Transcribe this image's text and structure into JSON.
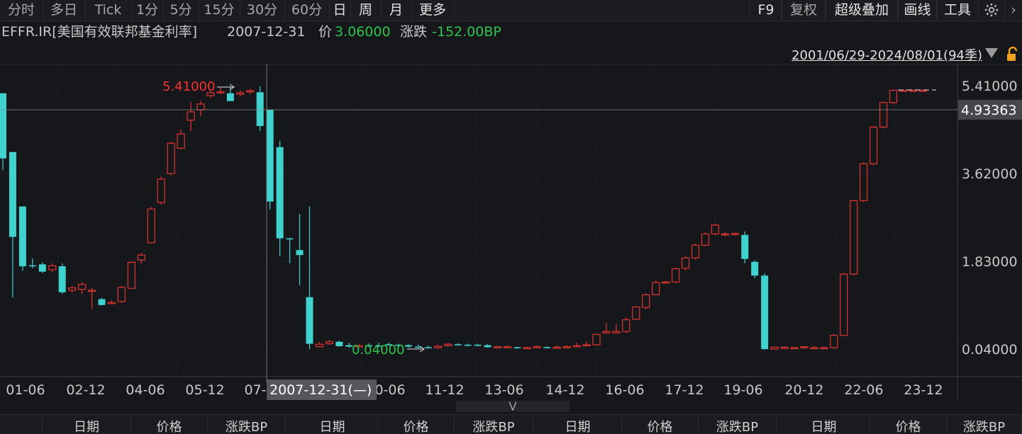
{
  "toolbar": {
    "left": [
      "分时",
      "多日",
      "Tick",
      "1分",
      "5分",
      "15分",
      "30分",
      "60分",
      "日",
      "周",
      "月",
      "更多"
    ],
    "right": [
      "F9",
      "复权",
      "超级叠加",
      "画线",
      "工具"
    ],
    "icons": [
      "gear-icon",
      "chevron-right-icon"
    ]
  },
  "info": {
    "symbol": "EFFR.IR[美国有效联邦基金利率]",
    "date": "2007-12-31",
    "price_label": "价",
    "price": "3.06000",
    "change_label": "涨跌",
    "change": "-152.00BP"
  },
  "range": {
    "label": "2001/06/29-2024/08/01(94季)"
  },
  "colors": {
    "up": "#e0342f",
    "down": "#3fd2cf",
    "up_text": "#ff3030",
    "down_text": "#2ec34a"
  },
  "chart_data": {
    "type": "candlestick",
    "ylim": [
      0,
      5.6
    ],
    "yticks": [
      "5.41000",
      "3.62000",
      "1.83000",
      "0.04000"
    ],
    "xticks": [
      "01-06",
      "02-12",
      "04-06",
      "05-12",
      "07-",
      "0-06",
      "11-12",
      "13-06",
      "14-12",
      "16-06",
      "17-12",
      "19-06",
      "20-12",
      "22-06",
      "23-12"
    ],
    "annotations": {
      "high": "5.41000",
      "low": "0.04000"
    },
    "crosshair": {
      "price": "4.93363",
      "date": "2007-12-31(—)"
    },
    "candles": [
      [
        5.27,
        3.94,
        5.27,
        3.7
      ],
      [
        4.07,
        2.34,
        4.07,
        1.1
      ],
      [
        2.96,
        1.74,
        2.96,
        1.65
      ],
      [
        1.76,
        1.75,
        1.9,
        1.7
      ],
      [
        1.78,
        1.63,
        1.82,
        1.6
      ],
      [
        1.67,
        1.75,
        1.8,
        1.62
      ],
      [
        1.74,
        1.21,
        1.8,
        1.18
      ],
      [
        1.25,
        1.3,
        1.34,
        1.2
      ],
      [
        1.27,
        1.37,
        1.42,
        1.18
      ],
      [
        1.23,
        1.25,
        1.3,
        0.87
      ],
      [
        1.07,
        0.95,
        1.1,
        0.94
      ],
      [
        0.99,
        1.0,
        1.05,
        0.98
      ],
      [
        1.02,
        1.31,
        1.34,
        1.0
      ],
      [
        1.29,
        1.82,
        1.84,
        1.29
      ],
      [
        1.87,
        1.97,
        2.01,
        1.79
      ],
      [
        2.22,
        2.91,
        2.95,
        2.22
      ],
      [
        3.04,
        3.52,
        3.57,
        3.0
      ],
      [
        3.63,
        4.25,
        4.28,
        3.6
      ],
      [
        4.15,
        4.44,
        4.53,
        4.12
      ],
      [
        4.72,
        4.89,
        5.09,
        4.5
      ],
      [
        4.93,
        5.05,
        5.11,
        4.8
      ],
      [
        5.22,
        5.28,
        5.31,
        5.17
      ],
      [
        5.28,
        5.3,
        5.38,
        5.25
      ],
      [
        5.27,
        5.11,
        5.41,
        5.11
      ],
      [
        5.25,
        5.28,
        5.33,
        5.2
      ],
      [
        5.32,
        5.32,
        5.37,
        5.25
      ],
      [
        5.29,
        4.6,
        5.41,
        4.5
      ],
      [
        4.93,
        3.06,
        4.93,
        2.9
      ],
      [
        4.17,
        2.31,
        4.3,
        1.95
      ],
      [
        2.31,
        2.3,
        2.32,
        1.8
      ],
      [
        2.07,
        1.97,
        2.81,
        1.35
      ],
      [
        1.11,
        0.16,
        2.96,
        0.05
      ],
      [
        0.1,
        0.15,
        0.2,
        0.09
      ],
      [
        0.16,
        0.2,
        0.24,
        0.14
      ],
      [
        0.2,
        0.11,
        0.22,
        0.1
      ],
      [
        0.13,
        0.1,
        0.18,
        0.08
      ],
      [
        0.11,
        0.12,
        0.16,
        0.1
      ],
      [
        0.13,
        0.11,
        0.17,
        0.09
      ],
      [
        0.12,
        0.11,
        0.18,
        0.1
      ],
      [
        0.15,
        0.13,
        0.18,
        0.12
      ],
      [
        0.14,
        0.12,
        0.16,
        0.1
      ],
      [
        0.13,
        0.1,
        0.15,
        0.08
      ],
      [
        0.1,
        0.09,
        0.14,
        0.07
      ],
      [
        0.09,
        0.08,
        0.12,
        0.06
      ],
      [
        0.08,
        0.11,
        0.14,
        0.06
      ],
      [
        0.12,
        0.15,
        0.18,
        0.1
      ],
      [
        0.15,
        0.14,
        0.17,
        0.12
      ],
      [
        0.14,
        0.13,
        0.16,
        0.11
      ],
      [
        0.14,
        0.13,
        0.16,
        0.11
      ],
      [
        0.13,
        0.09,
        0.15,
        0.08
      ],
      [
        0.09,
        0.1,
        0.11,
        0.07
      ],
      [
        0.1,
        0.1,
        0.12,
        0.08
      ],
      [
        0.09,
        0.08,
        0.1,
        0.06
      ],
      [
        0.07,
        0.08,
        0.1,
        0.06
      ],
      [
        0.09,
        0.1,
        0.12,
        0.07
      ],
      [
        0.09,
        0.08,
        0.11,
        0.07
      ],
      [
        0.08,
        0.09,
        0.12,
        0.07
      ],
      [
        0.08,
        0.1,
        0.13,
        0.07
      ],
      [
        0.12,
        0.12,
        0.18,
        0.09
      ],
      [
        0.13,
        0.14,
        0.21,
        0.12
      ],
      [
        0.14,
        0.35,
        0.36,
        0.12
      ],
      [
        0.38,
        0.41,
        0.58,
        0.37
      ],
      [
        0.38,
        0.41,
        0.56,
        0.37
      ],
      [
        0.41,
        0.65,
        0.7,
        0.38
      ],
      [
        0.66,
        0.91,
        0.93,
        0.64
      ],
      [
        0.9,
        1.16,
        1.19,
        0.86
      ],
      [
        1.16,
        1.41,
        1.45,
        1.15
      ],
      [
        1.41,
        1.42,
        1.44,
        1.4
      ],
      [
        1.42,
        1.69,
        1.71,
        1.4
      ],
      [
        1.7,
        1.91,
        1.94,
        1.65
      ],
      [
        1.91,
        2.17,
        2.2,
        1.88
      ],
      [
        2.17,
        2.4,
        2.43,
        2.15
      ],
      [
        2.4,
        2.58,
        2.61,
        2.37
      ],
      [
        2.39,
        2.4,
        2.45,
        2.35
      ],
      [
        2.4,
        2.41,
        2.43,
        2.36
      ],
      [
        2.38,
        1.89,
        2.45,
        1.8
      ],
      [
        1.83,
        1.55,
        1.86,
        1.5
      ],
      [
        1.55,
        0.05,
        1.6,
        0.04
      ],
      [
        0.05,
        0.09,
        0.1,
        0.04
      ],
      [
        0.07,
        0.09,
        0.1,
        0.05
      ],
      [
        0.08,
        0.08,
        0.1,
        0.07
      ],
      [
        0.08,
        0.1,
        0.11,
        0.06
      ],
      [
        0.07,
        0.08,
        0.12,
        0.06
      ],
      [
        0.08,
        0.08,
        0.1,
        0.06
      ],
      [
        0.08,
        0.33,
        0.36,
        0.06
      ],
      [
        0.33,
        1.58,
        1.6,
        0.32
      ],
      [
        1.58,
        3.08,
        3.1,
        1.55
      ],
      [
        3.08,
        3.83,
        3.86,
        3.05
      ],
      [
        3.83,
        4.58,
        4.6,
        3.8
      ],
      [
        4.58,
        5.08,
        5.1,
        4.55
      ],
      [
        5.08,
        5.33,
        5.35,
        5.05
      ],
      [
        5.33,
        5.33,
        5.34,
        5.32
      ],
      [
        5.33,
        5.33,
        5.34,
        5.32
      ],
      [
        5.33,
        5.33,
        5.34,
        5.32
      ]
    ]
  },
  "table_header": {
    "groups": [
      [
        "日期",
        "价格",
        "涨跌BP"
      ],
      [
        "日期",
        "价格",
        "涨跌BP"
      ],
      [
        "日期",
        "价格",
        "涨跌BP"
      ],
      [
        "日期",
        "价格",
        "涨跌BP"
      ]
    ]
  }
}
